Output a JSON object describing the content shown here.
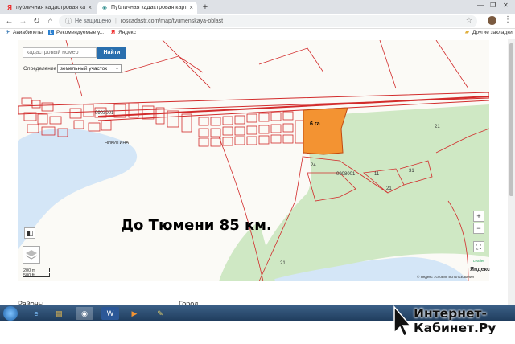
{
  "browser": {
    "tabs": [
      {
        "label": "публичная кадастровая карта",
        "favicon": "yandex-icon",
        "active": false
      },
      {
        "label": "Публичная кадастровая карта",
        "favicon": "globe-icon",
        "active": true
      }
    ],
    "address": {
      "security": "Не защищено",
      "url": "roscadastr.com/map/tyumenskaya-oblast"
    },
    "bookmarks": [
      {
        "label": "Авиабилеты",
        "icon": "plane-icon"
      },
      {
        "label": "Рекомендуемые у...",
        "icon": "bookmark-icon"
      },
      {
        "label": "Яндекс",
        "icon": "yandex-icon"
      }
    ],
    "other_bookmarks": "Другие закладки"
  },
  "search": {
    "placeholder": "кадастровый номер",
    "button": "Найти",
    "definition_label": "Определение",
    "definition_value": "земельный участок"
  },
  "map": {
    "labels": {
      "village": "НИКИТИНА",
      "cadastre1": "0903001",
      "cadastre2": "0908001",
      "parcel_21": "21",
      "parcel_24": "24",
      "parcel_11": "11",
      "parcel_31": "31",
      "parcel_21b": "21",
      "parcel_21c": "21"
    },
    "area_label": "6 га",
    "distance_text": "До Тюмени 85 км.",
    "scale": {
      "top": "200 m",
      "bottom": "500 ft"
    },
    "attribution": "© Яндекс  Условия использования",
    "provider": "Яндекс",
    "leaflet": "Leaflet",
    "zoom_in": "+",
    "zoom_out": "−",
    "colors": {
      "selected_parcel": "#f39332",
      "forest": "#cfe8c4",
      "river": "#cfe3f5",
      "cadastre_line": "#d22b2b"
    }
  },
  "below": {
    "left": "Районы",
    "right": "Город"
  },
  "watermark": {
    "line1": "Интернет-",
    "line2": "Кабинет.Ру"
  }
}
